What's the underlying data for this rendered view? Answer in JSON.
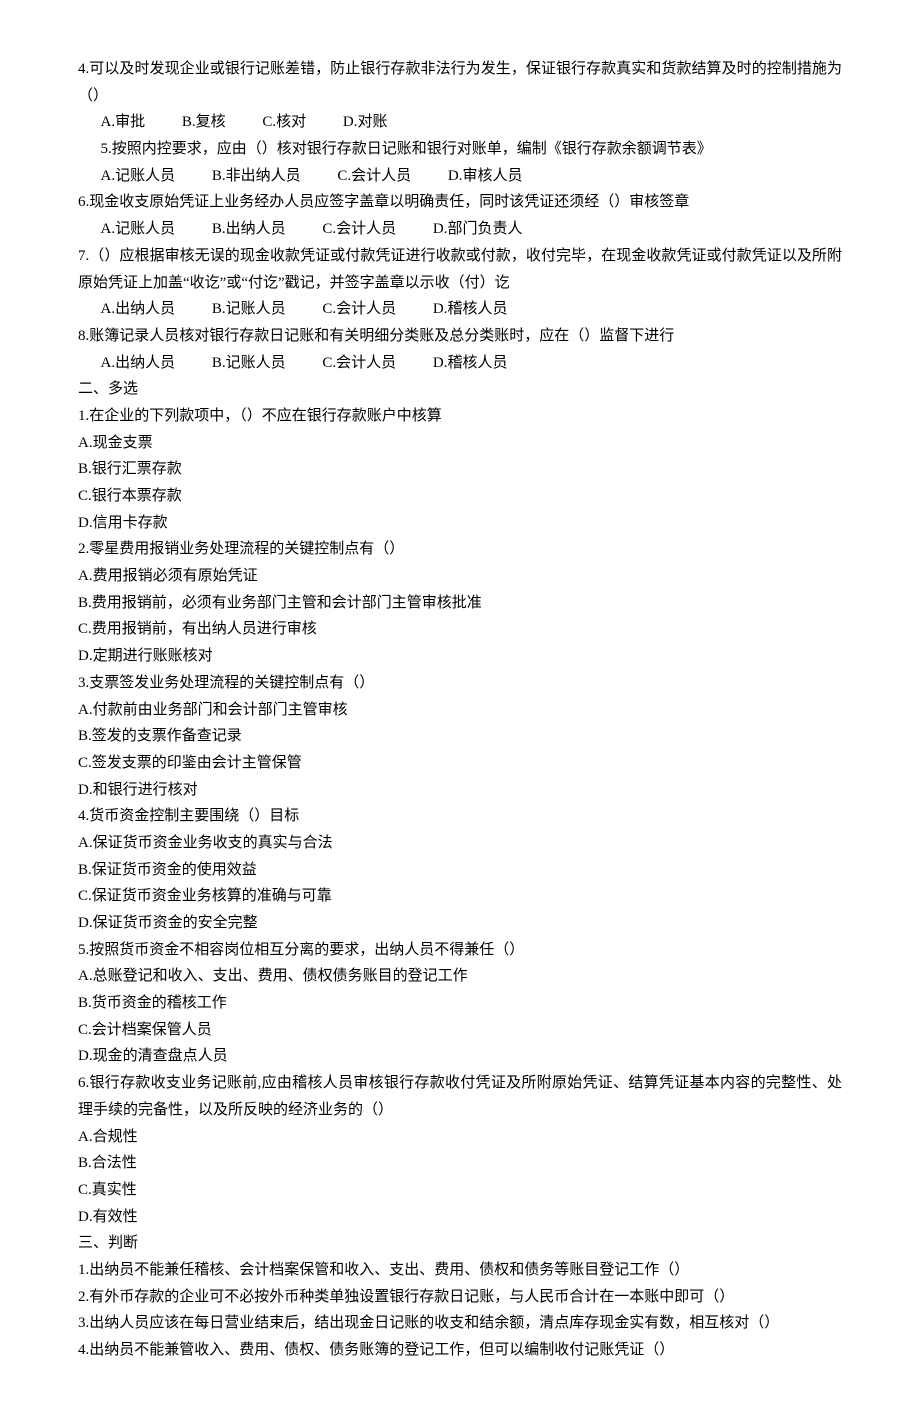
{
  "q4": {
    "text": "4.可以及时发现企业或银行记账差错，防止银行存款非法行为发生，保证银行存款真实和货款结算及时的控制措施为（）",
    "a": "A.审批",
    "b": "B.复核",
    "c": "C.核对",
    "d": "D.对账"
  },
  "q5": {
    "text": "5.按照内控要求，应由（）核对银行存款日记账和银行对账单，编制《银行存款余额调节表》",
    "a": "A.记账人员",
    "b": "B.非出纳人员",
    "c": "C.会计人员",
    "d": "D.审核人员"
  },
  "q6": {
    "text": "6.现金收支原始凭证上业务经办人员应签字盖章以明确责任，同时该凭证还须经（）审核签章",
    "a": "A.记账人员",
    "b": "B.出纳人员",
    "c": "C.会计人员",
    "d": "D.部门负责人"
  },
  "q7": {
    "text": "7.（）应根据审核无误的现金收款凭证或付款凭证进行收款或付款，收付完毕，在现金收款凭证或付款凭证以及所附原始凭证上加盖“收讫”或“付讫”戳记，并签字盖章以示收（付）讫",
    "a": "A.出纳人员",
    "b": "B.记账人员",
    "c": "C.会计人员",
    "d": "D.稽核人员"
  },
  "q8": {
    "text": "8.账簿记录人员核对银行存款日记账和有关明细分类账及总分类账时，应在（）监督下进行",
    "a": "A.出纳人员",
    "b": "B.记账人员",
    "c": "C.会计人员",
    "d": "D.稽核人员"
  },
  "sec2": "二、多选",
  "m1": {
    "text": "1.在企业的下列款项中，（）不应在银行存款账户中核算",
    "a": "A.现金支票",
    "b": "B.银行汇票存款",
    "c": "C.银行本票存款",
    "d": "D.信用卡存款"
  },
  "m2": {
    "text": "2.零星费用报销业务处理流程的关键控制点有（）",
    "a": "A.费用报销必须有原始凭证",
    "b": "B.费用报销前，必须有业务部门主管和会计部门主管审核批准",
    "c": "C.费用报销前，有出纳人员进行审核",
    "d": "D.定期进行账账核对"
  },
  "m3": {
    "text": "3.支票签发业务处理流程的关键控制点有（）",
    "a": "A.付款前由业务部门和会计部门主管审核",
    "b": "B.签发的支票作备查记录",
    "c": "C.签发支票的印鉴由会计主管保管",
    "d": "D.和银行进行核对"
  },
  "m4": {
    "text": "4.货币资金控制主要围绕（）目标",
    "a": "A.保证货币资金业务收支的真实与合法",
    "b": "B.保证货币资金的使用效益",
    "c": "C.保证货币资金业务核算的准确与可靠",
    "d": "D.保证货币资金的安全完整"
  },
  "m5": {
    "text": "5.按照货币资金不相容岗位相互分离的要求，出纳人员不得兼任（）",
    "a": "A.总账登记和收入、支出、费用、债权债务账目的登记工作",
    "b": "B.货币资金的稽核工作",
    "c": "C.会计档案保管人员",
    "d": "D.现金的清查盘点人员"
  },
  "m6": {
    "text": "6.银行存款收支业务记账前,应由稽核人员审核银行存款收付凭证及所附原始凭证、结算凭证基本内容的完整性、处理手续的完备性，以及所反映的经济业务的（）",
    "a": "A.合规性",
    "b": "B.合法性",
    "c": "C.真实性",
    "d": "D.有效性"
  },
  "sec3": "三、判断",
  "j1": "1.出纳员不能兼任稽核、会计档案保管和收入、支出、费用、债权和债务等账目登记工作（）",
  "j2": "2.有外币存款的企业可不必按外币种类单独设置银行存款日记账，与人民币合计在一本账中即可（）",
  "j3": "3.出纳人员应该在每日营业结束后，结出现金日记账的收支和结余额，清点库存现金实有数，相互核对（）",
  "j4": "4.出纳员不能兼管收入、费用、债权、债务账簿的登记工作，但可以编制收付记账凭证（）"
}
